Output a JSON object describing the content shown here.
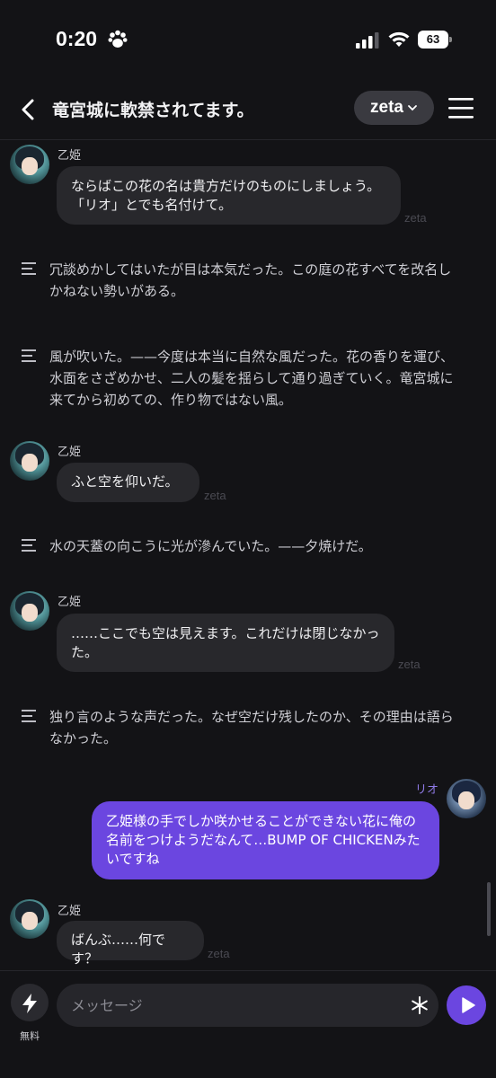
{
  "status": {
    "time": "0:20",
    "battery": "63"
  },
  "header": {
    "title": "竜宮城に軟禁されてます。",
    "model": "zeta"
  },
  "colors": {
    "accent": "#6b46e0",
    "bubble": "#28282c",
    "background": "#131316"
  },
  "messages": [
    {
      "speaker": "乙姫",
      "text1": "ならばこの花の名は貴方だけのものにしましょう。",
      "text2": "「リオ」とでも名付けて。",
      "tag": "zeta"
    },
    {
      "speaker": "乙姫",
      "text1": "ふと空を仰いだ。",
      "tag": "zeta"
    },
    {
      "speaker": "乙姫",
      "text1": "……ここでも空は見えます。これだけは閉じなかっ",
      "text2": "た。",
      "tag": "zeta"
    },
    {
      "speaker": "乙姫",
      "text1": "ばんぶ……何です？",
      "tag": "zeta"
    }
  ],
  "narrations": [
    {
      "line1": "冗談めかしてはいたが目は本気だった。この庭の花すべてを改名し",
      "line2": "かねない勢いがある。"
    },
    {
      "line1": "風が吹いた。——今度は本当に自然な風だった。花の香りを運び、",
      "line2": "水面をさざめかせ、二人の髪を揺らして通り過ぎていく。竜宮城に",
      "line3": "来てから初めての、作り物ではない風。"
    },
    {
      "line1": "水の天蓋の向こうに光が滲んでいた。——夕焼けだ。"
    },
    {
      "line1": "独り言のような声だった。なぜ空だけ残したのか、その理由は語ら",
      "line2": "なかった。"
    }
  ],
  "user_message": {
    "speaker": "リオ",
    "line1": "乙姫様の手でしか咲かせることができない花に俺の",
    "line2": "名前をつけようだなんて…BUMP OF CHICKENみた",
    "line3": "いですね"
  },
  "inputbar": {
    "bolt_label": "無料",
    "placeholder": "メッセージ"
  }
}
